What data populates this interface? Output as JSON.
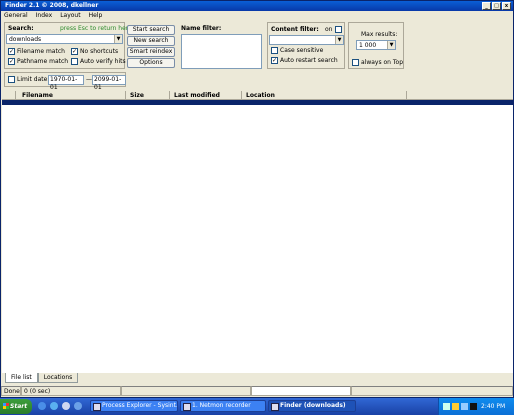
{
  "window": {
    "title": "Finder 2.1  © 2008, dkellner",
    "controls": [
      "_",
      "□",
      "x"
    ]
  },
  "menu": [
    "General",
    "Index",
    "Layout",
    "Help"
  ],
  "search": {
    "label": "Search:",
    "hint": "press Esc to return here",
    "value": "downloads",
    "options": [
      {
        "label": "Filename match",
        "checked": true
      },
      {
        "label": "No shortcuts",
        "checked": true
      },
      {
        "label": "Pathname match",
        "checked": true
      },
      {
        "label": "Auto verify hits",
        "checked": false
      }
    ]
  },
  "buttons": [
    "Start search",
    "New search",
    "Smart reindex",
    "Options"
  ],
  "name_filter": {
    "label": "Name filter:"
  },
  "content_filter": {
    "label": "Content filter:",
    "on_label": "on",
    "on_checked": false,
    "case_sensitive": {
      "label": "Case sensitive",
      "checked": false
    },
    "auto_restart": {
      "label": "Auto restart search",
      "checked": true
    }
  },
  "max_results": {
    "label": "Max results:",
    "value": "1 000",
    "always_on_top": {
      "label": "always on Top",
      "checked": false
    }
  },
  "limit_date": {
    "label": "Limit date:",
    "checked": false,
    "from": "1970-01-01",
    "separator": "—",
    "to": "2099-01-01"
  },
  "columns": [
    "Filename",
    "Size",
    "Last modified",
    "Location"
  ],
  "tabs": [
    "File list",
    "Locations"
  ],
  "status": [
    "Done",
    "0 (0 sec)"
  ],
  "taskbar": {
    "start": "Start",
    "tasks": [
      "Process Explorer - Sysint...",
      "1. Netmon recorder",
      "Finder (downloads)"
    ],
    "clock": "2:40 PM",
    "colors": {
      "taskbar": "#245edb",
      "start": "#3c9d3c",
      "tray": "#0f8cef"
    }
  }
}
